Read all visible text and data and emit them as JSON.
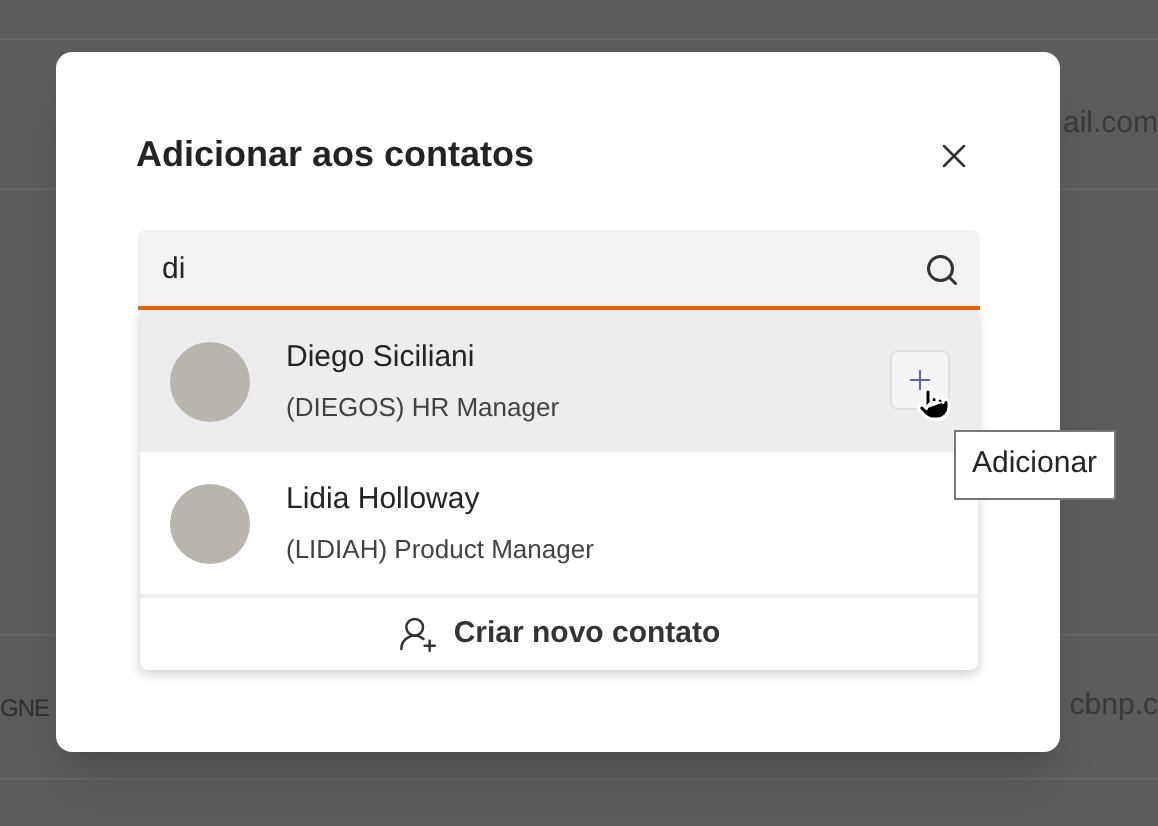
{
  "background": {
    "rows": [
      {
        "left": "",
        "right": "ail.com"
      },
      {
        "left": "GNE",
        "right": "cbnp.c"
      }
    ]
  },
  "dialog": {
    "title": "Adicionar aos contatos",
    "search": {
      "value": "di"
    },
    "results": [
      {
        "name": "Diego Siciliani",
        "detail": "(DIEGOS) HR Manager",
        "selected": true,
        "tooltip": "Adicionar"
      },
      {
        "name": "Lidia Holloway",
        "detail": "(LIDIAH) Product Manager",
        "selected": false
      }
    ],
    "create_button": "Criar novo contato"
  }
}
